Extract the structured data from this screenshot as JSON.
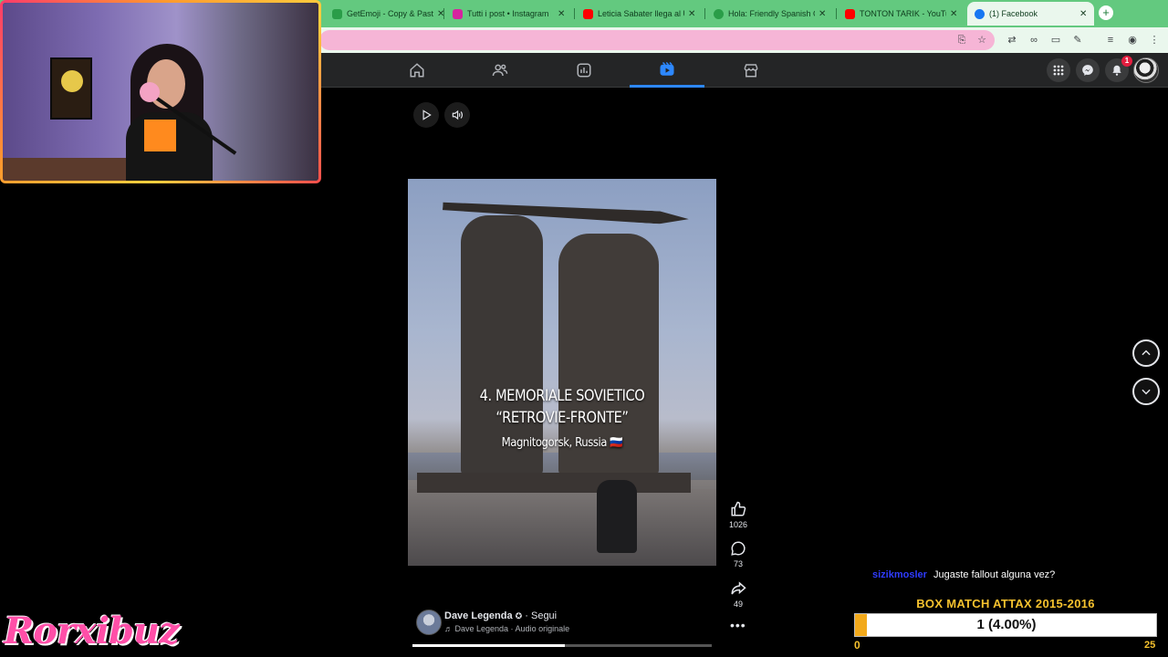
{
  "browser": {
    "tabs": [
      {
        "title": "GetEmoji - Copy & Paste",
        "favicon_color": "#2a9d48",
        "active": false
      },
      {
        "title": "Tutti i post • Instagram",
        "favicon_color": "#d6249f",
        "active": false
      },
      {
        "title": "Leticia Sabater llega al U",
        "favicon_color": "#ff0000",
        "active": false
      },
      {
        "title": "Hola: Friendly Spanish G",
        "favicon_color": "#2a9d48",
        "active": false
      },
      {
        "title": "TONTON TARIK - YouTub",
        "favicon_color": "#ff0000",
        "active": false
      },
      {
        "title": "(1) Facebook",
        "favicon_color": "#1877f2",
        "active": true
      }
    ],
    "new_tab_label": "+",
    "colors": {
      "tabbar": "#63c97f",
      "omnibox": "#f6b5d6"
    }
  },
  "facebook_nav": {
    "tabs": [
      "home-icon",
      "friends-icon",
      "feeds-icon",
      "video-icon",
      "marketplace-icon"
    ],
    "active_tab": "video-icon",
    "notification_count": "1",
    "accent": "#2d88ff"
  },
  "reel": {
    "caption_line1": "4. MEMORIALE SOVIETICO",
    "caption_line2": "“RETROVIE-FRONTE”",
    "caption_line3": "Magnitogorsk, Russia 🇷🇺",
    "likes": "1026",
    "comments": "73",
    "shares": "49",
    "author_name": "Dave Legenda",
    "follow_label": "· Segui",
    "audio_label": "♬ Dave Legenda · Audio originale",
    "progress_fraction": 0.51
  },
  "overlay": {
    "chat_user": "sizikmosler",
    "chat_message": "Jugaste fallout alguna vez?",
    "box_title": "BOX MATCH ATTAX 2015-2016",
    "box_value_text": "1 (4.00%)",
    "box_fraction": 0.04,
    "box_min": "0",
    "box_max": "25",
    "brand": "Rorxibuz"
  }
}
